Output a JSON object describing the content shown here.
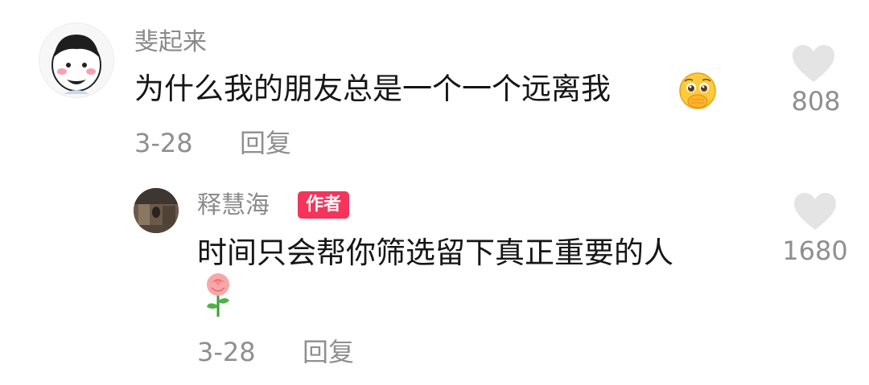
{
  "comment": {
    "author": "斐起来",
    "text": "为什么我的朋友总是一个一个远离我",
    "emoji": "pleading-face-covering-mouth-emoji",
    "date": "3-28",
    "reply_label": "回复",
    "likes": "808"
  },
  "reply": {
    "author": "释慧海",
    "badge": "作者",
    "text": "时间只会帮你筛选留下真正重要的人",
    "emoji": "rose-emoji",
    "date": "3-28",
    "reply_label": "回复",
    "likes": "1680"
  },
  "colors": {
    "badge_bg": "#f5345c",
    "meta_text": "#8f8f8f",
    "heart": "#e4e4e4"
  }
}
